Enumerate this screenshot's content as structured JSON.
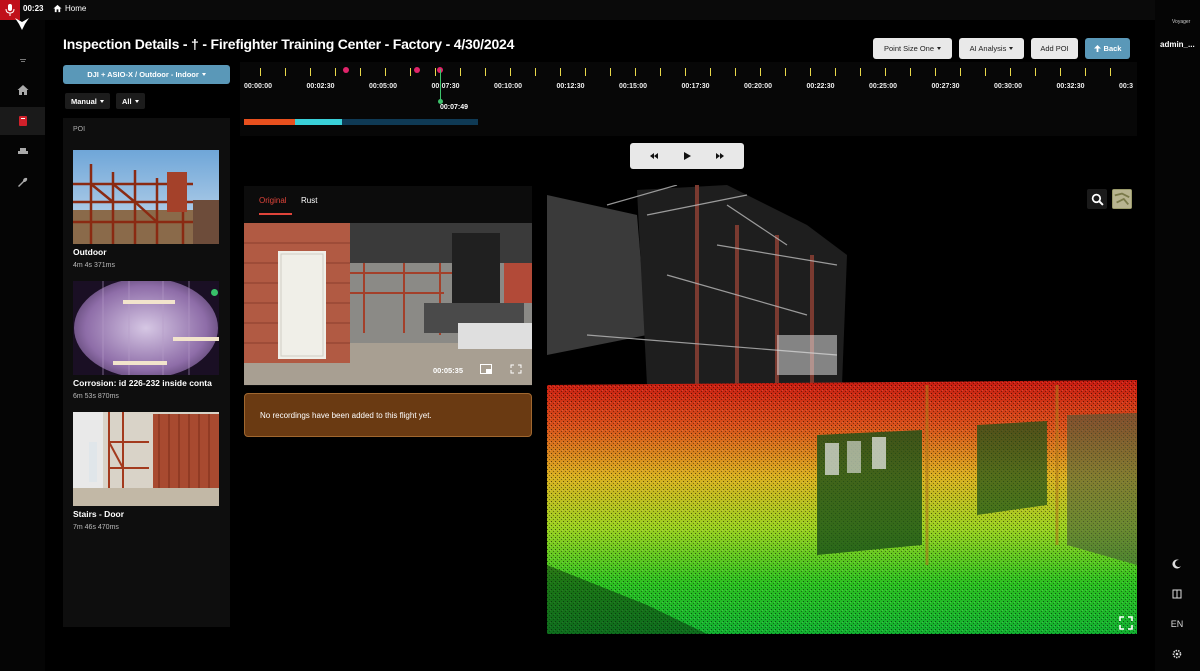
{
  "topbar": {
    "rec_time": "00:23",
    "home": "Home"
  },
  "header": {
    "title": "Inspection Details - † - Firefighter Training Center - Factory - 4/30/2024",
    "buttons": {
      "point_size": "Point Size One",
      "ai_analysis": "AI Analysis",
      "add_poi": "Add POI",
      "back": "Back"
    }
  },
  "left": {
    "drone_select": "DJI + ASIO-X / Outdoor - Indoor",
    "filter_mode": "Manual",
    "filter_all": "All",
    "poi_label": "POI",
    "pois": [
      {
        "name": "Outdoor",
        "time": "4m 4s 371ms"
      },
      {
        "name": "Corrosion: id 226-232 inside conta",
        "time": "6m 53s 870ms"
      },
      {
        "name": "Stairs - Door",
        "time": "7m 46s 470ms"
      }
    ]
  },
  "timeline": {
    "labels": [
      "00:00:00",
      "00:02:30",
      "00:05:00",
      "00:07:30",
      "00:10:00",
      "00:12:30",
      "00:15:00",
      "00:17:30",
      "00:20:00",
      "00:22:30",
      "00:25:00",
      "00:27:30",
      "00:30:00",
      "00:32:30",
      "00:3"
    ],
    "playhead": "00:07:49",
    "progress": {
      "orange_fraction": 0.22,
      "cyan_fraction": 0.2
    }
  },
  "video": {
    "tabs": {
      "original": "Original",
      "rust": "Rust"
    },
    "time": "00:05:35"
  },
  "notice": "No recordings have been added to this flight yet.",
  "right_rail": {
    "user_top": "Voyager",
    "user": "admin_...",
    "lang": "EN"
  },
  "colors": {
    "accent": "#5a98b8",
    "rec": "#c0101a",
    "marker": "#e0246a",
    "tick": "#e8d84a",
    "playhead": "#3ec36c",
    "notice_bg": "#6a3a12"
  }
}
